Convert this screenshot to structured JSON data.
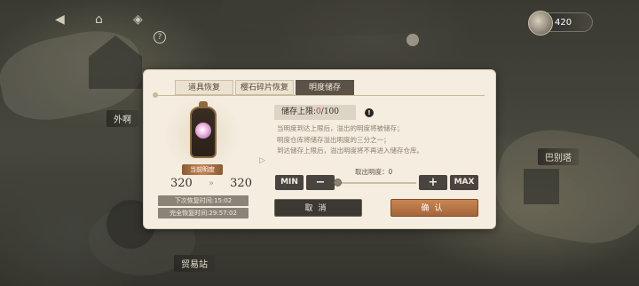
{
  "map": {
    "labels": {
      "left": "外啊",
      "right": "巴别塔",
      "bottom": "贸易站"
    }
  },
  "currency": {
    "value": "420"
  },
  "dialog": {
    "tabs": [
      {
        "label": "道具恢复",
        "active": false
      },
      {
        "label": "樱石碎片恢复",
        "active": false
      },
      {
        "label": "明度储存",
        "active": true
      }
    ],
    "current_label": "当前明度",
    "current_value": "320",
    "next_value": "320",
    "next_recover_label": "下次恢复时间:",
    "next_recover_time": "15:02",
    "full_recover_label": "完全恢复时间:",
    "full_recover_time": "29:57:02",
    "cap_label": "储存上限:",
    "cap_current": "0",
    "cap_max": "/100",
    "desc_lines": [
      "当明度到达上限后，溢出的明度将被储存；",
      "明度仓库将储存溢出明度的三分之一；",
      "到达储存上限后，溢出明度将不再进入储存仓库。"
    ],
    "take_label": "取出明度：",
    "take_value": "0",
    "min_label": "MIN",
    "minus_label": "−",
    "plus_label": "+",
    "max_label": "MAX",
    "cancel_label": "取消",
    "confirm_label": "确认"
  }
}
